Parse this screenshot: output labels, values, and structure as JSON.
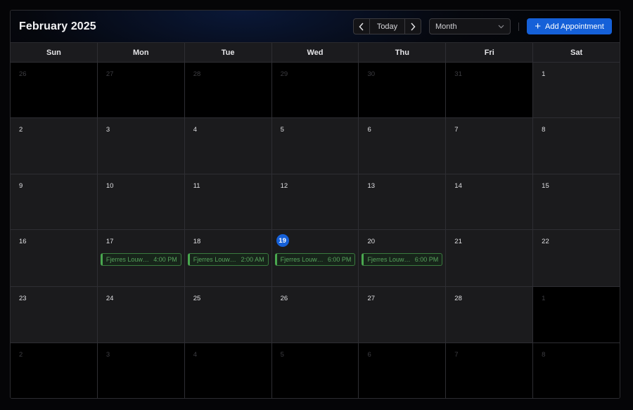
{
  "header": {
    "title": "February 2025",
    "today_label": "Today",
    "prev_icon": "chevron-left-icon",
    "next_icon": "chevron-right-icon",
    "view": "Month",
    "add_label": "Add Appointment"
  },
  "weekdays": [
    "Sun",
    "Mon",
    "Tue",
    "Wed",
    "Thu",
    "Fri",
    "Sat"
  ],
  "weeks": [
    {
      "days": [
        {
          "n": "26",
          "out": true
        },
        {
          "n": "27",
          "out": true
        },
        {
          "n": "28",
          "out": true
        },
        {
          "n": "29",
          "out": true
        },
        {
          "n": "30",
          "out": true
        },
        {
          "n": "31",
          "out": true
        },
        {
          "n": "1"
        }
      ]
    },
    {
      "days": [
        {
          "n": "2"
        },
        {
          "n": "3"
        },
        {
          "n": "4"
        },
        {
          "n": "5"
        },
        {
          "n": "6"
        },
        {
          "n": "7"
        },
        {
          "n": "8"
        }
      ]
    },
    {
      "days": [
        {
          "n": "9"
        },
        {
          "n": "10"
        },
        {
          "n": "11"
        },
        {
          "n": "12"
        },
        {
          "n": "13"
        },
        {
          "n": "14"
        },
        {
          "n": "15"
        }
      ]
    },
    {
      "days": [
        {
          "n": "16"
        },
        {
          "n": "17",
          "event": {
            "name": "Fjerres Louwe...",
            "time": "4:00 PM"
          }
        },
        {
          "n": "18",
          "event": {
            "name": "Fjerres Louwe...",
            "time": "2:00 AM"
          }
        },
        {
          "n": "19",
          "today": true,
          "event": {
            "name": "Fjerres Louwe...",
            "time": "6:00 PM"
          }
        },
        {
          "n": "20",
          "event": {
            "name": "Fjerres Louwe...",
            "time": "6:00 PM"
          }
        },
        {
          "n": "21"
        },
        {
          "n": "22"
        }
      ]
    },
    {
      "days": [
        {
          "n": "23"
        },
        {
          "n": "24"
        },
        {
          "n": "25"
        },
        {
          "n": "26"
        },
        {
          "n": "27"
        },
        {
          "n": "28"
        },
        {
          "n": "1",
          "out": true
        }
      ]
    },
    {
      "days": [
        {
          "n": "2",
          "out": true
        },
        {
          "n": "3",
          "out": true
        },
        {
          "n": "4",
          "out": true
        },
        {
          "n": "5",
          "out": true
        },
        {
          "n": "6",
          "out": true
        },
        {
          "n": "7",
          "out": true
        },
        {
          "n": "8",
          "out": true
        }
      ]
    }
  ],
  "colors": {
    "accent": "#1560d8",
    "event_border": "#4aa84f",
    "event_text": "#57a35c",
    "cell_bg": "#1b1b1d",
    "outside_bg": "#000000"
  }
}
